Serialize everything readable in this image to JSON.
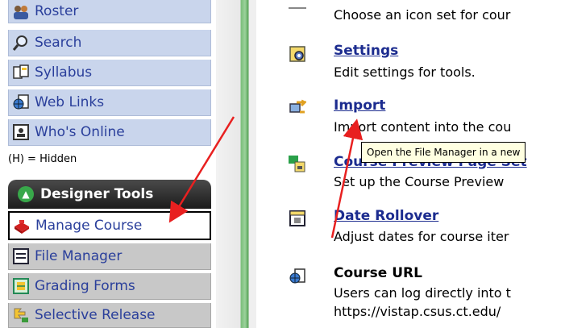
{
  "sidebar": {
    "items": [
      {
        "label": "Roster",
        "icon": "roster-icon"
      },
      {
        "label": "Search",
        "icon": "search-icon"
      },
      {
        "label": "Syllabus",
        "icon": "syllabus-icon"
      },
      {
        "label": "Web Links",
        "icon": "web-links-icon"
      },
      {
        "label": "Who's Online",
        "icon": "whos-online-icon"
      }
    ],
    "hidden_note": "(H) = Hidden",
    "designer_tools": {
      "title": "Designer Tools",
      "items": [
        {
          "label": "Manage Course",
          "icon": "manage-course-icon",
          "active": true
        },
        {
          "label": "File Manager",
          "icon": "file-manager-icon"
        },
        {
          "label": "Grading Forms",
          "icon": "grading-forms-icon"
        },
        {
          "label": "Selective Release",
          "icon": "selective-release-icon"
        }
      ]
    }
  },
  "main": {
    "entries": [
      {
        "title": "",
        "desc": "Choose an icon set for cour",
        "icon": "icon-set-icon"
      },
      {
        "title": "Settings",
        "desc": "Edit settings for tools.",
        "icon": "settings-icon"
      },
      {
        "title": "Import",
        "desc": "Import content into the cou",
        "icon": "import-icon"
      },
      {
        "title": "Course Preview Page Set",
        "desc": "Set up the Course Preview",
        "icon": "course-preview-icon"
      },
      {
        "title": "Date Rollover",
        "desc": "Adjust dates for course iter",
        "icon": "date-rollover-icon"
      },
      {
        "title": "Course URL",
        "desc": "Users can log directly into t",
        "desc2": "https://vistap.csus.ct.edu/",
        "icon": "course-url-icon"
      }
    ]
  },
  "tooltip": "Open the File Manager in a new",
  "colors": {
    "accent_link": "#1c2c8f",
    "nav_text": "#2a3f9b",
    "arrow": "#e82020"
  }
}
